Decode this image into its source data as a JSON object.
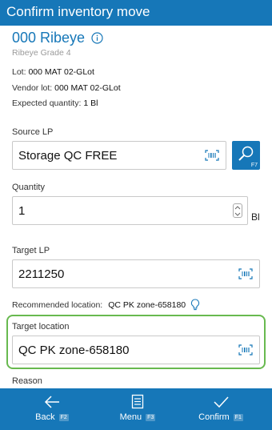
{
  "header": {
    "title": "Confirm inventory move"
  },
  "item": {
    "name": "000 Ribeye",
    "grade": "Ribeye Grade 4"
  },
  "details": {
    "lot_label": "Lot:",
    "lot_value": "000 MAT 02-GLot",
    "vendor_lot_label": "Vendor lot:",
    "vendor_lot_value": "000 MAT 02-GLot",
    "expected_qty_label": "Expected quantity:",
    "expected_qty_value": "1 Bl"
  },
  "source_lp": {
    "label": "Source LP",
    "value": "Storage QC FREE",
    "lookup_key": "F7"
  },
  "quantity": {
    "label": "Quantity",
    "value": "1",
    "unit": "Bl"
  },
  "target_lp": {
    "label": "Target LP",
    "value": "2211250"
  },
  "recommended": {
    "label": "Recommended location:",
    "value": "QC PK zone-658180"
  },
  "target_location": {
    "label": "Target location",
    "value": "QC PK zone-658180"
  },
  "reason": {
    "label": "Reason"
  },
  "footer": {
    "back": {
      "label": "Back",
      "key": "F2"
    },
    "menu": {
      "label": "Menu",
      "key": "F3"
    },
    "confirm": {
      "label": "Confirm",
      "key": "F1"
    }
  },
  "colors": {
    "brand": "#1677b8",
    "highlight": "#68b94f"
  }
}
